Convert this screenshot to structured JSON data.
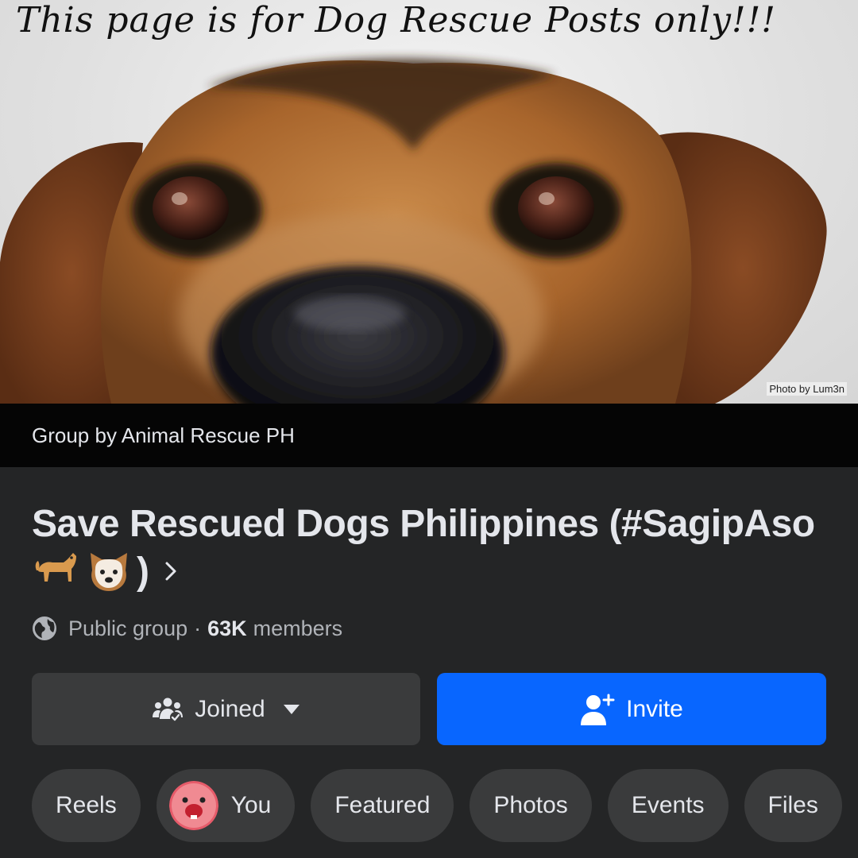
{
  "cover": {
    "caption": "This page is for Dog Rescue Posts only!!!",
    "photo_credit": "Photo by Lum3n"
  },
  "group_by": "Group by Animal Rescue PH",
  "group": {
    "title": "Save Rescued Dogs Philippines (#SagipAso",
    "title_end": ")",
    "privacy": "Public group",
    "separator": "·",
    "member_count": "63K",
    "member_suffix": "members"
  },
  "actions": {
    "joined_label": "Joined",
    "invite_label": "Invite"
  },
  "tabs": [
    {
      "label": "Reels"
    },
    {
      "label": "You"
    },
    {
      "label": "Featured"
    },
    {
      "label": "Photos"
    },
    {
      "label": "Events"
    },
    {
      "label": "Files"
    }
  ],
  "colors": {
    "background": "#242526",
    "group_by_bar": "#050505",
    "button_secondary": "#3a3b3c",
    "button_primary": "#0866ff",
    "text_primary": "#e4e6eb",
    "text_secondary": "#b0b3b8"
  },
  "icons": {
    "globe": "globe-icon",
    "chevron": "chevron-right-icon",
    "joined": "group-members-icon",
    "caret": "caret-down-icon",
    "invite": "add-person-icon",
    "you_avatar": "user-avatar"
  }
}
